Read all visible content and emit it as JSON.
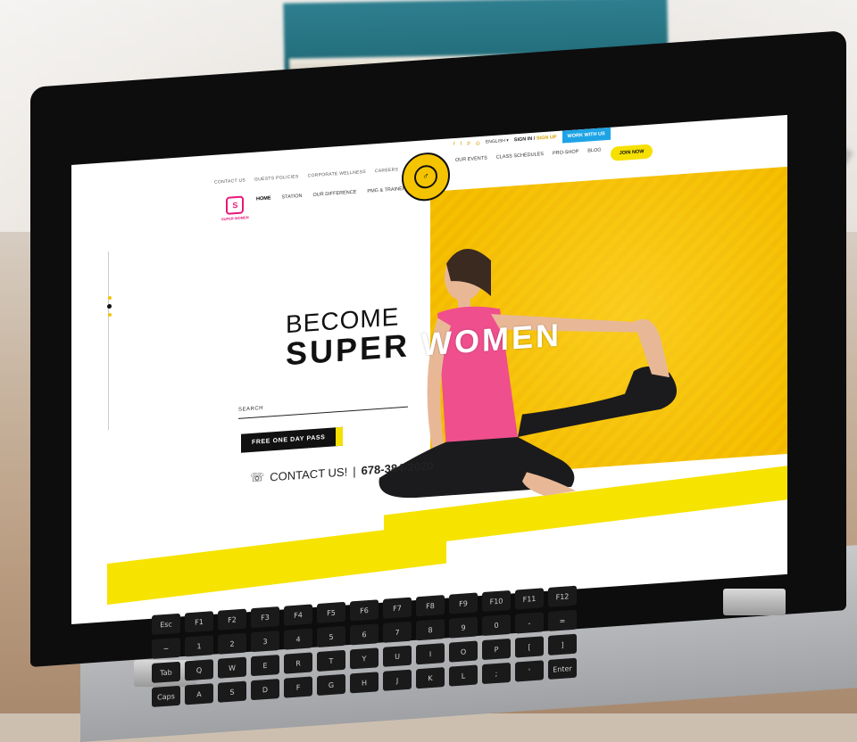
{
  "site": {
    "topbar": [
      "CONTACT US",
      "GUESTS POLICIES",
      "CORPORATE WELLNESS",
      "CAREERS"
    ],
    "utility": {
      "language": "ENGLISH ▾",
      "sign_in": "SIGN IN",
      "separator": " / ",
      "sign_up": "SIGN UP",
      "work_with_us": "WORK WITH US"
    },
    "brand": {
      "logo_text": "GOLD'S GYM",
      "sub_brand": "SUPER WOMEN"
    },
    "nav_left": [
      "HOME",
      "STATION",
      "OUR DIFFERENCE",
      "PMG & TRAINER"
    ],
    "nav_right": [
      "OUR EVENTS",
      "CLASS SCHEDULES",
      "PRO-SHOP",
      "BLOG"
    ],
    "join_now": "JOIN NOW",
    "hero": {
      "line1": "BECOME",
      "line2a": "SUPER ",
      "line2b": "WOMEN",
      "search_label": "SEARCH",
      "cta": "FREE ONE DAY PASS",
      "contact_label": "CONTACT US!",
      "contact_sep": " | ",
      "phone": "678-384-2020"
    }
  },
  "colors": {
    "brand_yellow": "#f5c000",
    "accent_pink": "#e8177a",
    "accent_blue": "#1ea4e6"
  },
  "keyboard": {
    "row1": [
      "Esc",
      "F1",
      "F2",
      "F3",
      "F4",
      "F5",
      "F6",
      "F7",
      "F8",
      "F9",
      "F10",
      "F11",
      "F12"
    ],
    "row2": [
      "~",
      "1",
      "2",
      "3",
      "4",
      "5",
      "6",
      "7",
      "8",
      "9",
      "0",
      "-",
      "="
    ],
    "row3": [
      "Tab",
      "Q",
      "W",
      "E",
      "R",
      "T",
      "Y",
      "U",
      "I",
      "O",
      "P",
      "[",
      "]"
    ],
    "row4": [
      "Caps",
      "A",
      "S",
      "D",
      "F",
      "G",
      "H",
      "J",
      "K",
      "L",
      ";",
      "'",
      "Enter"
    ]
  }
}
